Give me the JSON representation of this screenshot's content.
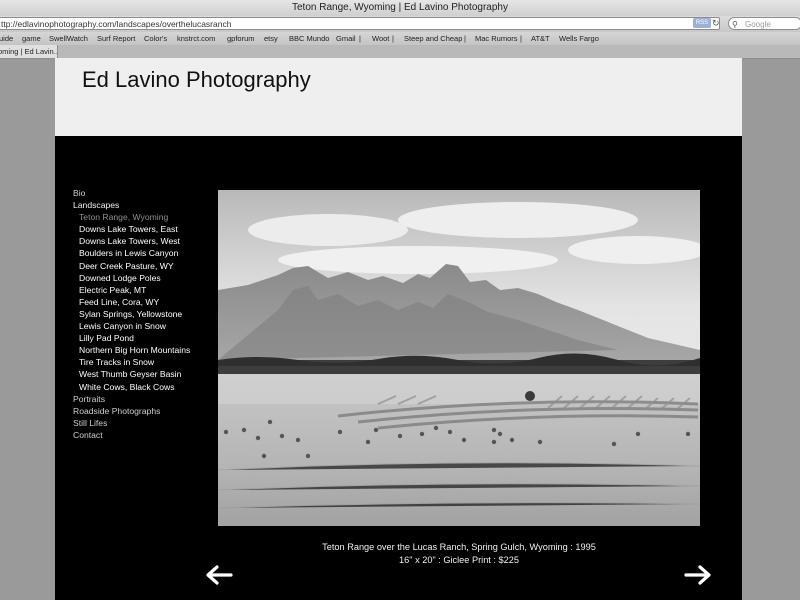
{
  "browser": {
    "window_title": "Teton Range, Wyoming | Ed Lavino Photography",
    "url": "ttp://edlavinophotography.com/landscapes/overthelucasranch",
    "rss_label": "RSS",
    "search_placeholder": "Google",
    "bookmarks": [
      "uide",
      "game",
      "SwellWatch",
      "Surf Report",
      "Color's",
      "knstrct.com",
      "gpforum",
      "etsy",
      "BBC Mundo",
      "Gmail",
      "|",
      "Woot",
      "|",
      "Steep and Cheap",
      "|",
      "Mac Rumors",
      "|",
      "AT&T",
      "Wells Fargo"
    ],
    "tab_label": "oming | Ed Lavin..."
  },
  "site": {
    "title": "Ed Lavino Photography"
  },
  "nav": {
    "bio": "Bio",
    "landscapes": "Landscapes",
    "landscape_items": [
      "Teton Range, Wyoming",
      "Downs Lake Towers, East",
      "Downs Lake Towers, West",
      "Boulders in Lewis Canyon",
      "Deer Creek Pasture, WY",
      "Downed Lodge Poles",
      "Electric Peak, MT",
      "Feed Line, Cora, WY",
      "Sylan Springs, Yellowstone",
      "Lewis Canyon in Snow",
      "Lilly Pad Pond",
      "Northern Big Horn Mountains",
      "Tire Tracks in Snow",
      "West Thumb Geyser Basin",
      "White Cows, Black Cows"
    ],
    "portraits": "Portraits",
    "roadside": "Roadside Photographs",
    "still_lifes": "Still Lifes",
    "contact": "Contact"
  },
  "photo": {
    "caption_line1": "Teton Range over the Lucas Ranch, Spring Gulch, Wyoming : 1995",
    "caption_line2": "16\" x 20\" : Giclee Print : $225"
  },
  "icons": {
    "prev": "left-arrow-icon",
    "next": "right-arrow-icon"
  }
}
